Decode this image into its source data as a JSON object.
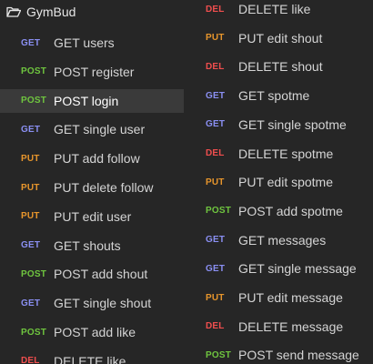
{
  "folder": {
    "name": "GymBud",
    "icon": "folder-open-icon"
  },
  "left_requests": [
    {
      "method": "GET",
      "name": "GET users",
      "selected": false
    },
    {
      "method": "POST",
      "name": "POST register",
      "selected": false
    },
    {
      "method": "POST",
      "name": "POST login",
      "selected": true
    },
    {
      "method": "GET",
      "name": "GET single user",
      "selected": false
    },
    {
      "method": "PUT",
      "name": "PUT add follow",
      "selected": false
    },
    {
      "method": "PUT",
      "name": "PUT delete follow",
      "selected": false
    },
    {
      "method": "PUT",
      "name": "PUT edit user",
      "selected": false
    },
    {
      "method": "GET",
      "name": "GET shouts",
      "selected": false
    },
    {
      "method": "POST",
      "name": "POST add shout",
      "selected": false
    },
    {
      "method": "GET",
      "name": "GET single shout",
      "selected": false
    },
    {
      "method": "POST",
      "name": "POST add like",
      "selected": false
    },
    {
      "method": "DEL",
      "name": "DELETE like",
      "selected": false
    }
  ],
  "right_requests": [
    {
      "method": "DEL",
      "name": "DELETE like",
      "selected": false
    },
    {
      "method": "PUT",
      "name": "PUT edit shout",
      "selected": false
    },
    {
      "method": "DEL",
      "name": "DELETE shout",
      "selected": false
    },
    {
      "method": "GET",
      "name": "GET spotme",
      "selected": false
    },
    {
      "method": "GET",
      "name": "GET single spotme",
      "selected": false
    },
    {
      "method": "DEL",
      "name": "DELETE spotme",
      "selected": false
    },
    {
      "method": "PUT",
      "name": "PUT edit spotme",
      "selected": false
    },
    {
      "method": "POST",
      "name": "POST add spotme",
      "selected": false
    },
    {
      "method": "GET",
      "name": "GET messages",
      "selected": false
    },
    {
      "method": "GET",
      "name": "GET single message",
      "selected": false
    },
    {
      "method": "PUT",
      "name": "PUT edit message",
      "selected": false
    },
    {
      "method": "DEL",
      "name": "DELETE message",
      "selected": false
    },
    {
      "method": "POST",
      "name": "POST send message",
      "selected": false
    }
  ],
  "colors": {
    "background": "#262626",
    "selected_row": "#3a3a3a",
    "GET": "#8a8ff2",
    "POST": "#6fc53f",
    "PUT": "#e8962c",
    "DEL": "#ef4e4e"
  }
}
